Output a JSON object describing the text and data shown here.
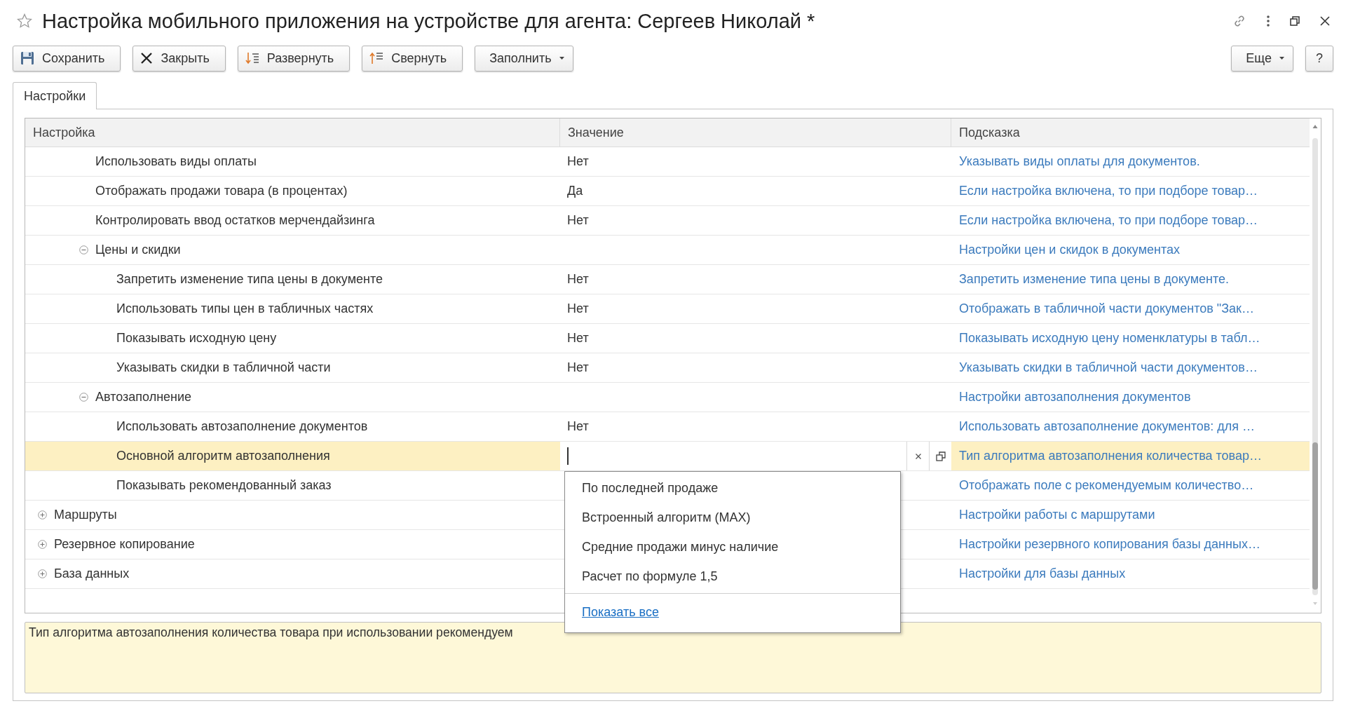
{
  "window": {
    "title": "Настройка мобильного приложения на устройстве для агента: Сергеев Николай *"
  },
  "toolbar": {
    "buttons": [
      {
        "label": "Сохранить",
        "kind": "icon"
      },
      {
        "label": "Закрыть",
        "kind": "icon"
      },
      {
        "label": "Развернуть",
        "kind": "icon"
      },
      {
        "label": "Свернуть",
        "kind": "icon"
      },
      {
        "label": "Заполнить",
        "kind": "menu"
      }
    ],
    "right_buttons": [
      {
        "label": "Еще",
        "kind": "menu"
      },
      {
        "label": "?",
        "kind": "plain"
      }
    ]
  },
  "tabs": [
    {
      "label": "Настройки",
      "selected": true
    }
  ],
  "table": {
    "columns": [
      "Настройка",
      "Значение",
      "Подсказка"
    ],
    "rows": [
      {
        "children": [
          {
            "kind": "setting",
            "label": "Использовать виды оплаты",
            "value": "Нет",
            "hint": "Указывать виды оплаты для документов.",
            "selected": false
          },
          {
            "kind": "setting",
            "label": "Отображать продажи товара (в процентах)",
            "value": "Да",
            "hint": "Если настройка включена, то при подборе товар…",
            "selected": false
          },
          {
            "kind": "setting",
            "label": "Контролировать ввод остатков мерчендайзинга",
            "value": "Нет",
            "hint": "Если настройка включена, то при подборе товар…",
            "selected": false
          },
          {
            "kind": "group",
            "label": "Цены и скидки",
            "hint": "Настройки цен и скидок в документах",
            "expanded": true,
            "selected": false,
            "children": [
              {
                "kind": "setting",
                "label": "Запретить изменение типа цены в документе",
                "value": "Нет",
                "hint": "Запретить изменение типа цены в документе.",
                "selected": false
              },
              {
                "kind": "setting",
                "label": "Использовать типы цен в табличных частях",
                "value": "Нет",
                "hint": "Отображать в табличной части документов \"Зак…",
                "selected": false
              },
              {
                "kind": "setting",
                "label": "Показывать исходную цену",
                "value": "Нет",
                "hint": "Показывать исходную цену номенклатуры в табл…",
                "selected": false
              },
              {
                "kind": "setting",
                "label": "Указывать скидки в табличной части",
                "value": "Нет",
                "hint": "Указывать скидки в табличной части документов…",
                "selected": false
              }
            ]
          },
          {
            "kind": "group",
            "label": "Автозаполнение",
            "hint": "Настройки автозаполнения документов",
            "expanded": true,
            "selected": false,
            "children": [
              {
                "kind": "setting",
                "label": "Использовать автозаполнение документов",
                "value": "Нет",
                "hint": "Использовать автозаполнение документов: для …",
                "selected": false
              },
              {
                "kind": "setting",
                "label": "Основной алгоритм автозаполнения",
                "hint": "Тип алгоритма автозаполнения количества товар…",
                "selected": true
              },
              {
                "kind": "setting",
                "label": "Показывать рекомендованный заказ",
                "hint": "Отображать поле с рекомендуемым количество…",
                "selected": false
              }
            ]
          }
        ]
      },
      {
        "kind": "group",
        "label": "Маршруты",
        "hint": "Настройки работы с маршрутами",
        "expanded": false,
        "selected": false
      },
      {
        "kind": "group",
        "label": "Резервное копирование",
        "hint": "Настройки резервного копирования базы данных…",
        "expanded": false,
        "selected": false
      },
      {
        "kind": "group",
        "label": "База данных",
        "hint": "Настройки для базы данных",
        "expanded": false,
        "selected": false
      }
    ]
  },
  "dropdown": {
    "items": [
      "По последней продаже",
      "Встроенный алгоритм (MAX)",
      "Средние продажи минус наличие",
      "Расчет по формуле 1,5"
    ],
    "show_all": "Показать все"
  },
  "note": {
    "text": "Тип алгоритма автозаполнения количества товара при использовании рекомендуем"
  }
}
